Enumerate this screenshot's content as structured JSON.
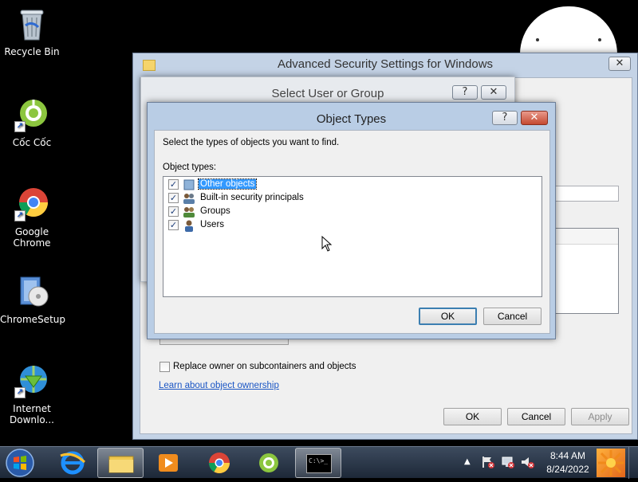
{
  "desktop": {
    "icons": [
      {
        "label_1": "Recycle Bin",
        "label_2": ""
      },
      {
        "label_1": "Cốc Cốc",
        "label_2": ""
      },
      {
        "label_1": "Google",
        "label_2": "Chrome"
      },
      {
        "label_1": "ChromeSetup",
        "label_2": ""
      },
      {
        "label_1": "Internet",
        "label_2": "Downlo..."
      }
    ]
  },
  "adv_window": {
    "title": "Advanced Security Settings for Windows",
    "close_glyph": "✕",
    "replace_owner_label": "Replace owner on subcontainers and objects",
    "learn_link": "Learn about object ownership",
    "ok_label": "OK",
    "cancel_label": "Cancel",
    "apply_label": "Apply"
  },
  "select_user_window": {
    "title": "Select User or Group",
    "help_glyph": "?",
    "close_glyph": "✕"
  },
  "object_types_dialog": {
    "title": "Object Types",
    "help_glyph": "?",
    "close_glyph": "✕",
    "instruction": "Select the types of objects you want to find.",
    "list_label": "Object types:",
    "items": [
      {
        "label": "Other objects",
        "checked": true,
        "selected": true
      },
      {
        "label": "Built-in security principals",
        "checked": true,
        "selected": false
      },
      {
        "label": "Groups",
        "checked": true,
        "selected": false
      },
      {
        "label": "Users",
        "checked": true,
        "selected": false
      }
    ],
    "check_glyph": "✓",
    "ok_label": "OK",
    "cancel_label": "Cancel"
  },
  "taskbar": {
    "time": "8:44 AM",
    "date": "8/24/2022",
    "cmd_prompt_text": "C:\\>_"
  },
  "colors": {
    "accent": "#3399ff",
    "link": "#1a55c4",
    "close_red": "#c44a32"
  }
}
